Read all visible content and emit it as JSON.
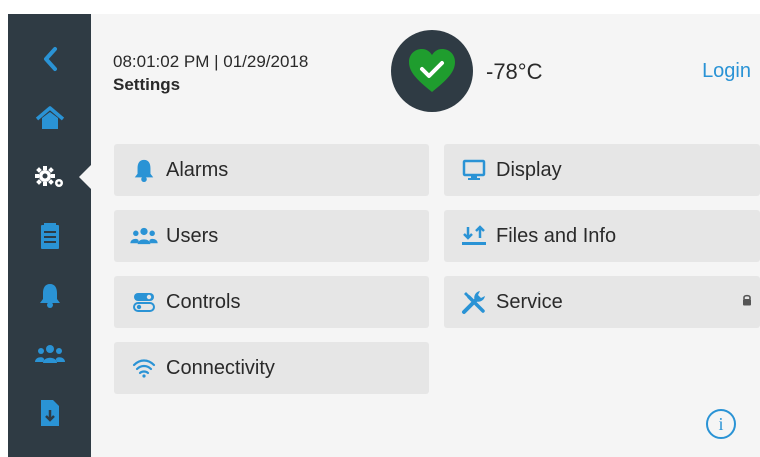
{
  "header": {
    "datetime": "08:01:02 PM | 01/29/2018",
    "title": "Settings",
    "temperature": "-78°C",
    "login_label": "Login",
    "status": "ok"
  },
  "sidebar": {
    "items": [
      {
        "icon": "back-chevron-icon"
      },
      {
        "icon": "home-icon"
      },
      {
        "icon": "gears-icon",
        "active": true
      },
      {
        "icon": "clipboard-icon"
      },
      {
        "icon": "bell-icon"
      },
      {
        "icon": "users-icon"
      },
      {
        "icon": "file-download-icon"
      }
    ]
  },
  "menu": {
    "alarms": "Alarms",
    "display": "Display",
    "users": "Users",
    "files_info": "Files and Info",
    "controls": "Controls",
    "service": "Service",
    "connectivity": "Connectivity"
  },
  "colors": {
    "accent": "#2a93d5",
    "sidebar": "#2f3b44",
    "status_ok": "#1f9d2e"
  },
  "info_label": "i"
}
